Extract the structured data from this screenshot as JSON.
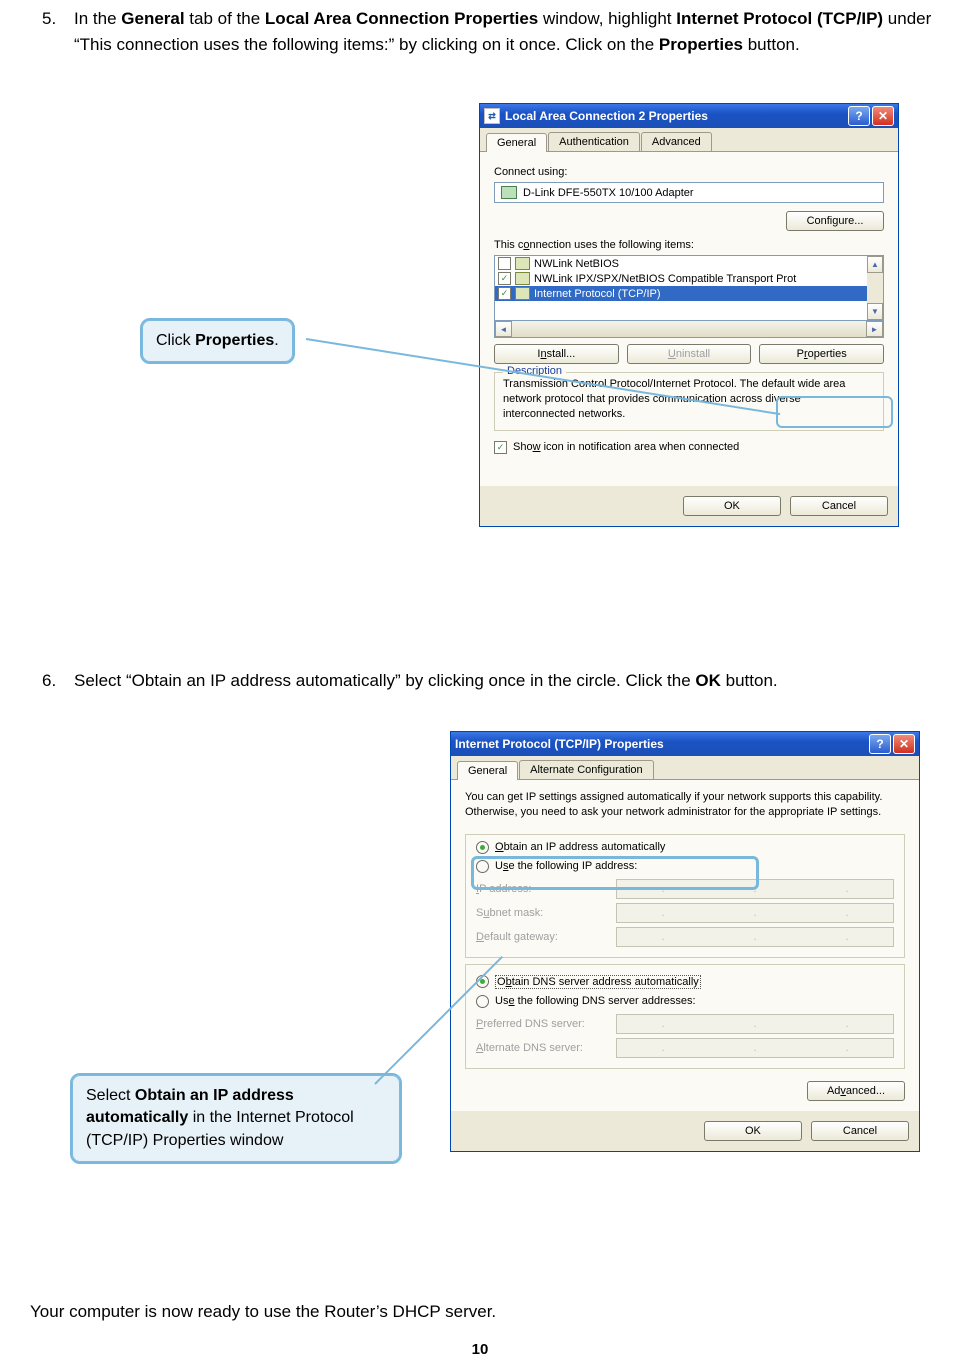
{
  "step5": {
    "number": "5.",
    "text_part1": "In the ",
    "bold1": "General",
    "text_part2": " tab of the ",
    "bold2": "Local Area Connection Properties",
    "text_part3": " window, highlight ",
    "bold3": "Internet Protocol (TCP/IP)",
    "text_part4": " under “This connection uses the following items:” by clicking on it once. Click on the ",
    "bold4": "Properties",
    "text_part5": " button."
  },
  "callout1": {
    "pre": "Click ",
    "bold": "Properties",
    "post": "."
  },
  "win1": {
    "title": "Local Area Connection 2 Properties",
    "tabs": [
      "General",
      "Authentication",
      "Advanced"
    ],
    "connect_using_label": "Connect using:",
    "adapter": "D-Link DFE-550TX 10/100 Adapter",
    "configure_btn": "Configure...",
    "items_label": "This connection uses the following items:",
    "items": [
      {
        "checked": false,
        "label": "NWLink NetBIOS"
      },
      {
        "checked": true,
        "label": "NWLink IPX/SPX/NetBIOS Compatible Transport Prot"
      },
      {
        "checked": true,
        "label": "Internet Protocol (TCP/IP)",
        "selected": true
      }
    ],
    "install_btn": "Install...",
    "uninstall_btn": "Uninstall",
    "properties_btn": "Properties",
    "description_legend": "Description",
    "description_text": "Transmission Control Protocol/Internet Protocol. The default wide area network protocol that provides communication across diverse interconnected networks.",
    "show_icon": "Show icon in notification area when connected",
    "ok_btn": "OK",
    "cancel_btn": "Cancel"
  },
  "step6": {
    "number": "6.",
    "text_part1": "Select “Obtain an IP address automatically” by clicking once in the circle. Click the ",
    "bold1": "OK",
    "text_part2": " button."
  },
  "callout2": {
    "pre": "Select ",
    "bold": "Obtain an IP address automatically",
    "post": " in the Internet Protocol (TCP/IP) Properties window"
  },
  "win2": {
    "title": "Internet Protocol (TCP/IP) Properties",
    "tabs": [
      "General",
      "Alternate Configuration"
    ],
    "intro": "You can get IP settings assigned automatically if your network supports this capability. Otherwise, you need to ask your network administrator for the appropriate IP settings.",
    "opt_auto_ip": "Obtain an IP address automatically",
    "opt_static_ip": "Use the following IP address:",
    "ip_label": "IP address:",
    "mask_label": "Subnet mask:",
    "gw_label": "Default gateway:",
    "opt_auto_dns": "Obtain DNS server address automatically",
    "opt_static_dns": "Use the following DNS server addresses:",
    "dns1_label": "Preferred DNS server:",
    "dns2_label": "Alternate DNS server:",
    "advanced_btn": "Advanced...",
    "ok_btn": "OK",
    "cancel_btn": "Cancel"
  },
  "closing": "Your computer is now ready to use the Router’s DHCP server.",
  "page_number": "10"
}
